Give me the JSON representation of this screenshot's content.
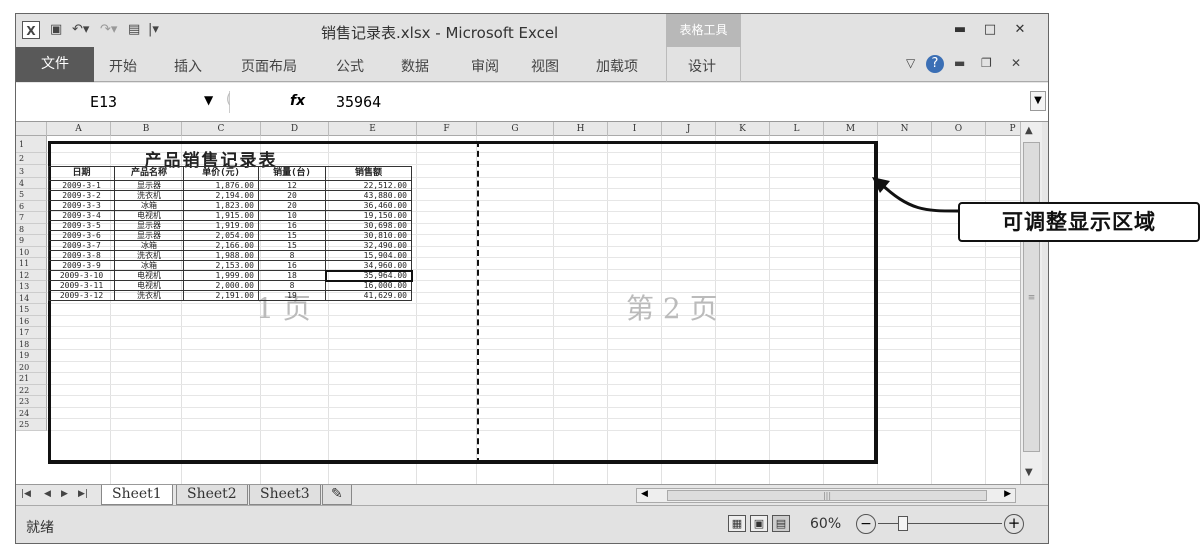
{
  "window": {
    "title": "销售记录表.xlsx - Microsoft Excel",
    "table_tools": "表格工具",
    "excel_icon": "X",
    "quick_access": [
      "save-icon",
      "undo-icon",
      "redo-icon",
      "print-preview-icon",
      "customize-icon"
    ]
  },
  "ribbon": {
    "tabs": [
      "文件",
      "开始",
      "插入",
      "页面布局",
      "公式",
      "数据",
      "审阅",
      "视图",
      "加载项",
      "设计"
    ]
  },
  "formula_bar": {
    "name_box": "E13",
    "fx": "fx",
    "value": "35964"
  },
  "columns": [
    "A",
    "B",
    "C",
    "D",
    "E",
    "F",
    "G",
    "H",
    "I",
    "J",
    "K",
    "L",
    "M",
    "N",
    "O",
    "P"
  ],
  "rows": [
    "1",
    "2",
    "3",
    "4",
    "5",
    "6",
    "7",
    "8",
    "9",
    "10",
    "11",
    "12",
    "13",
    "14",
    "15",
    "16",
    "17",
    "18",
    "19",
    "20",
    "21",
    "22",
    "23",
    "24",
    "25"
  ],
  "sheet": {
    "title": "产品销售记录表",
    "headers": [
      "日期",
      "产品名称",
      "单价(元)",
      "销量(台)",
      "销售额"
    ],
    "rows": [
      [
        "2009-3-1",
        "显示器",
        "1,876.00",
        "12",
        "22,512.00"
      ],
      [
        "2009-3-2",
        "洗衣机",
        "2,194.00",
        "20",
        "43,880.00"
      ],
      [
        "2009-3-3",
        "冰箱",
        "1,823.00",
        "20",
        "36,460.00"
      ],
      [
        "2009-3-4",
        "电视机",
        "1,915.00",
        "10",
        "19,150.00"
      ],
      [
        "2009-3-5",
        "显示器",
        "1,919.00",
        "16",
        "30,698.00"
      ],
      [
        "2009-3-6",
        "显示器",
        "2,054.00",
        "15",
        "30,810.00"
      ],
      [
        "2009-3-7",
        "冰箱",
        "2,166.00",
        "15",
        "32,490.00"
      ],
      [
        "2009-3-8",
        "洗衣机",
        "1,988.00",
        "8",
        "15,904.00"
      ],
      [
        "2009-3-9",
        "冰箱",
        "2,153.00",
        "16",
        "34,960.00"
      ],
      [
        "2009-3-10",
        "电视机",
        "1,999.00",
        "18",
        "35,964.00"
      ],
      [
        "2009-3-11",
        "电视机",
        "2,000.00",
        "8",
        "16,000.00"
      ],
      [
        "2009-3-12",
        "洗衣机",
        "2,191.00",
        "19",
        "41,629.00"
      ]
    ]
  },
  "page_labels": {
    "page1": "1 页",
    "page2": "第 2 页"
  },
  "sheet_tabs": [
    "Sheet1",
    "Sheet2",
    "Sheet3"
  ],
  "status": {
    "ready": "就绪",
    "zoom": "60%",
    "zoom_level_percent": 60
  },
  "callout": {
    "text": "可调整显示区域"
  }
}
